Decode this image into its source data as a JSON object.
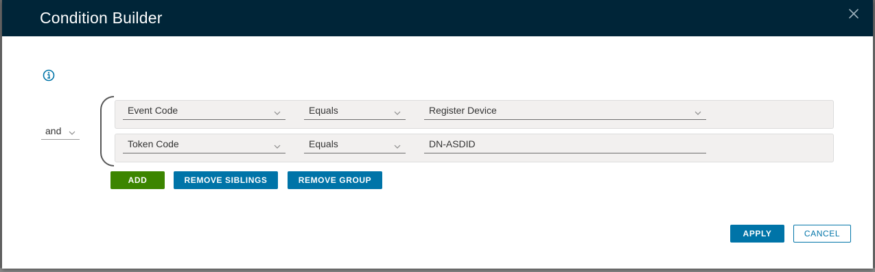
{
  "dialog": {
    "title": "Condition Builder",
    "close_icon": "close-icon",
    "info_icon": "info-icon"
  },
  "group": {
    "operator": "and",
    "conditions": [
      {
        "field": "Event Code",
        "operator": "Equals",
        "value": "Register Device",
        "value_is_dropdown": true
      },
      {
        "field": "Token Code",
        "operator": "Equals",
        "value": "DN-ASDID",
        "value_is_dropdown": false
      }
    ]
  },
  "actions": {
    "add": "ADD",
    "remove_siblings": "REMOVE SIBLINGS",
    "remove_group": "REMOVE GROUP"
  },
  "footer": {
    "apply": "APPLY",
    "cancel": "CANCEL"
  },
  "colors": {
    "header_bg": "#002538",
    "primary": "#0074a8",
    "add_green": "#3c8500",
    "row_bg": "#f2f0ef"
  }
}
